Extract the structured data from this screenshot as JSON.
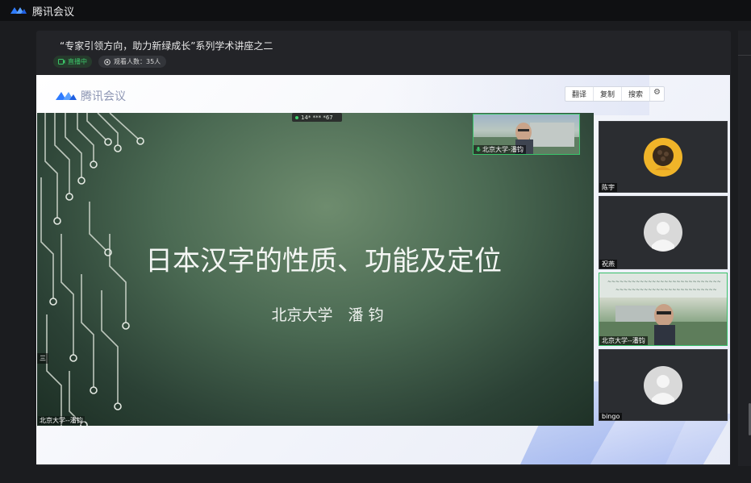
{
  "app": {
    "name": "腾讯会议"
  },
  "meeting": {
    "title": "“专家引领方向，助力新绿成长”系列学术讲座之二",
    "live_label": "直播中",
    "viewers_label": "观看人数：35人"
  },
  "stage": {
    "logo_text": "腾讯会议",
    "toolbar": {
      "translate": "翻译",
      "copy": "复制",
      "search": "搜索"
    }
  },
  "slide": {
    "title": "日本汉字的性质、功能及定位",
    "subtitle": "北京大学　潘 钧",
    "network": "14* *** *67",
    "presenter_overlay": "北京大学--潘钧",
    "side_tag": "三"
  },
  "pip": {
    "name": "北京大学-潘钧"
  },
  "participants": [
    {
      "name": "陈宇",
      "avatar": "photo"
    },
    {
      "name": "祝燕",
      "avatar": "default"
    },
    {
      "name": "北京大学--潘钧",
      "avatar": "video",
      "active": true
    },
    {
      "name": "bingo",
      "avatar": "default"
    }
  ],
  "colors": {
    "accent_green": "#38c06a",
    "brand_blue": "#1f6bff",
    "panel_bg": "#232428"
  }
}
